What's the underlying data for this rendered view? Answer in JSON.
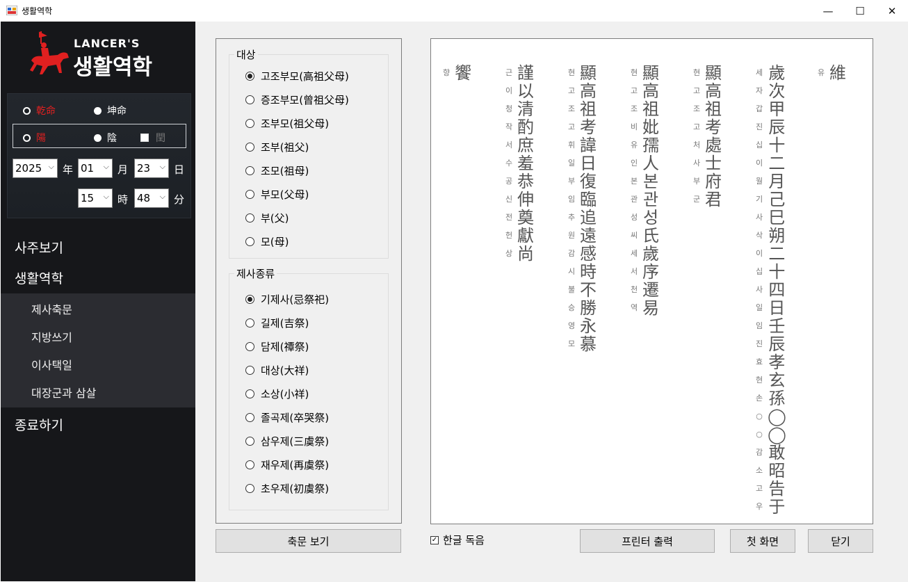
{
  "window": {
    "title": "생활역학",
    "min": "—",
    "max": "☐",
    "close": "✕"
  },
  "logo": {
    "en": "LANCER'S",
    "ko": "생활역학"
  },
  "gender": {
    "male": "乾命",
    "female": "坤命"
  },
  "calendar": {
    "solar": "陽",
    "lunar": "陰",
    "leap": "閏"
  },
  "date": {
    "year": "2025",
    "year_unit": "年",
    "month": "01",
    "month_unit": "月",
    "day": "23",
    "day_unit": "日",
    "hour": "15",
    "hour_unit": "時",
    "minute": "48",
    "minute_unit": "分"
  },
  "menu": {
    "saju": "사주보기",
    "life": "생활역학",
    "sub": [
      "제사축문",
      "지방쓰기",
      "이사택일",
      "대장군과 삼살"
    ],
    "exit": "종료하기"
  },
  "target_group": {
    "label": "대상",
    "options": [
      "고조부모(高祖父母)",
      "증조부모(曾祖父母)",
      "조부모(祖父母)",
      "조부(祖父)",
      "조모(祖母)",
      "부모(父母)",
      "부(父)",
      "모(母)"
    ],
    "selected": 0
  },
  "rite_group": {
    "label": "제사종류",
    "options": [
      "기제사(忌祭祀)",
      "길제(吉祭)",
      "담제(禫祭)",
      "대상(大祥)",
      "소상(小祥)",
      "졸곡제(卒哭祭)",
      "삼우제(三虞祭)",
      "재우제(再虞祭)",
      "초우제(初虞祭)"
    ],
    "selected": 0
  },
  "buttons": {
    "view": "축문 보기",
    "print": "프린터 출력",
    "home": "첫 화면",
    "close": "닫기"
  },
  "reading_checkbox": {
    "label": "한글 독음",
    "checked": true,
    "mark": "✓"
  },
  "prayer_columns": [
    {
      "hangul": "유",
      "hanja": "維"
    },
    {
      "hangul": "세자갑진십이월기사삭이십사일임진효현손○○감소고우",
      "hanja": "歲次甲辰十二月己巳朔二十四日壬辰孝玄孫◯◯敢昭告于"
    },
    {
      "hangul": "현고조고처사부군",
      "hanja": "顯高祖考處士府君"
    },
    {
      "hangul": "현고조비유인본관성씨세서천역",
      "hanja": "顯高祖妣孺人본관성氏歲序遷易"
    },
    {
      "hangul": "현고조고휘일부임추원감시불승영모",
      "hanja": "顯高祖考諱日復臨追遠感時不勝永慕"
    },
    {
      "hangul": "근이청작서수공신전헌상",
      "hanja": "謹以清酌庶羞恭伸奠獻尚"
    },
    {
      "hangul": "향",
      "hanja": "饗"
    }
  ]
}
